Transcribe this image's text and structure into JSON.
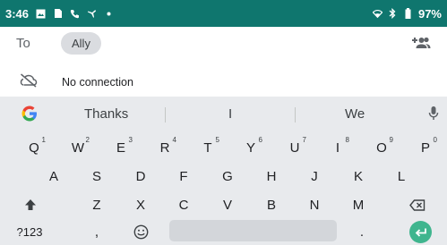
{
  "status_bar": {
    "time": "3:46",
    "battery": "97%",
    "left_icons": [
      "image-icon",
      "sim-icon",
      "phone-icon",
      "airplane-call-icon",
      "dot-icon"
    ],
    "right_icons": [
      "wifi-icon",
      "bluetooth-icon",
      "battery-icon"
    ]
  },
  "compose": {
    "to_label": "To",
    "recipient_chip": "Ally"
  },
  "connection": {
    "text": "No connection"
  },
  "keyboard": {
    "suggestions": [
      "Thanks",
      "I",
      "We"
    ],
    "row1": [
      {
        "k": "Q",
        "h": "1"
      },
      {
        "k": "W",
        "h": "2"
      },
      {
        "k": "E",
        "h": "3"
      },
      {
        "k": "R",
        "h": "4"
      },
      {
        "k": "T",
        "h": "5"
      },
      {
        "k": "Y",
        "h": "6"
      },
      {
        "k": "U",
        "h": "7"
      },
      {
        "k": "I",
        "h": "8"
      },
      {
        "k": "O",
        "h": "9"
      },
      {
        "k": "P",
        "h": "0"
      }
    ],
    "row2": [
      "A",
      "S",
      "D",
      "F",
      "G",
      "H",
      "J",
      "K",
      "L"
    ],
    "row3": [
      "Z",
      "X",
      "C",
      "V",
      "B",
      "N",
      "M"
    ],
    "numbers_key": "?123",
    "comma_key": ",",
    "period_key": "."
  },
  "colors": {
    "status_bar": "#0f766e",
    "keyboard_bg": "#e8eaed",
    "enter_key": "#3fb58e"
  }
}
